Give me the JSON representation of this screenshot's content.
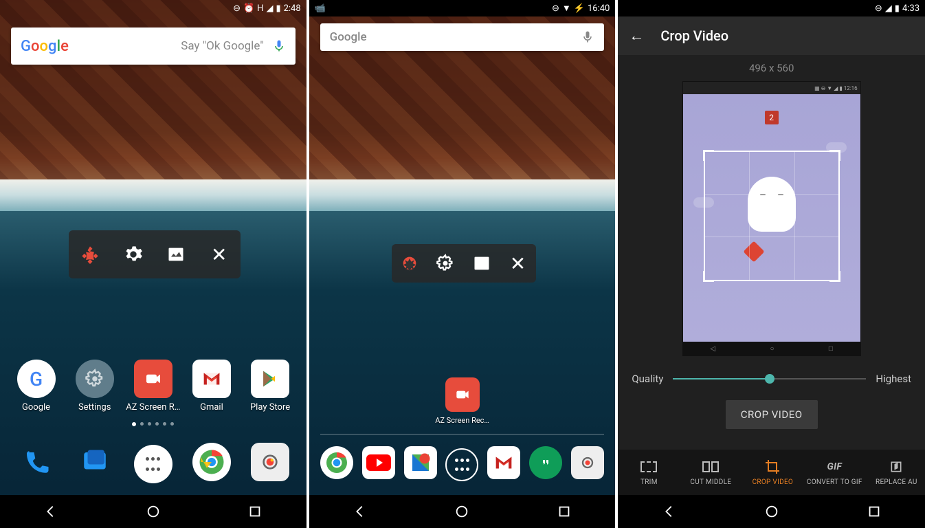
{
  "phone1": {
    "status": {
      "time": "2:48",
      "indicator": "H"
    },
    "search": {
      "logo": "Google",
      "placeholder": "Say \"Ok Google\""
    },
    "apps": [
      {
        "name": "Google"
      },
      {
        "name": "Settings"
      },
      {
        "name": "AZ Screen R…"
      },
      {
        "name": "Gmail"
      },
      {
        "name": "Play Store"
      }
    ]
  },
  "phone2": {
    "status": {
      "time": "16:40"
    },
    "search": {
      "logo": "Google"
    },
    "app": {
      "name": "AZ Screen Rec…"
    }
  },
  "phone3": {
    "status": {
      "time": "4:33"
    },
    "title": "Crop Video",
    "dimensions": "496 x 560",
    "preview": {
      "badge": "2",
      "inner_time": "12:16"
    },
    "quality": {
      "label": "Quality",
      "value_label": "Highest",
      "percent": 50
    },
    "button": "CROP VIDEO",
    "tools": [
      {
        "label": "TRIM"
      },
      {
        "label": "CUT MIDDLE"
      },
      {
        "label": "CROP VIDEO",
        "active": true
      },
      {
        "label": "CONVERT TO GIF"
      },
      {
        "label": "REPLACE AU"
      }
    ]
  }
}
